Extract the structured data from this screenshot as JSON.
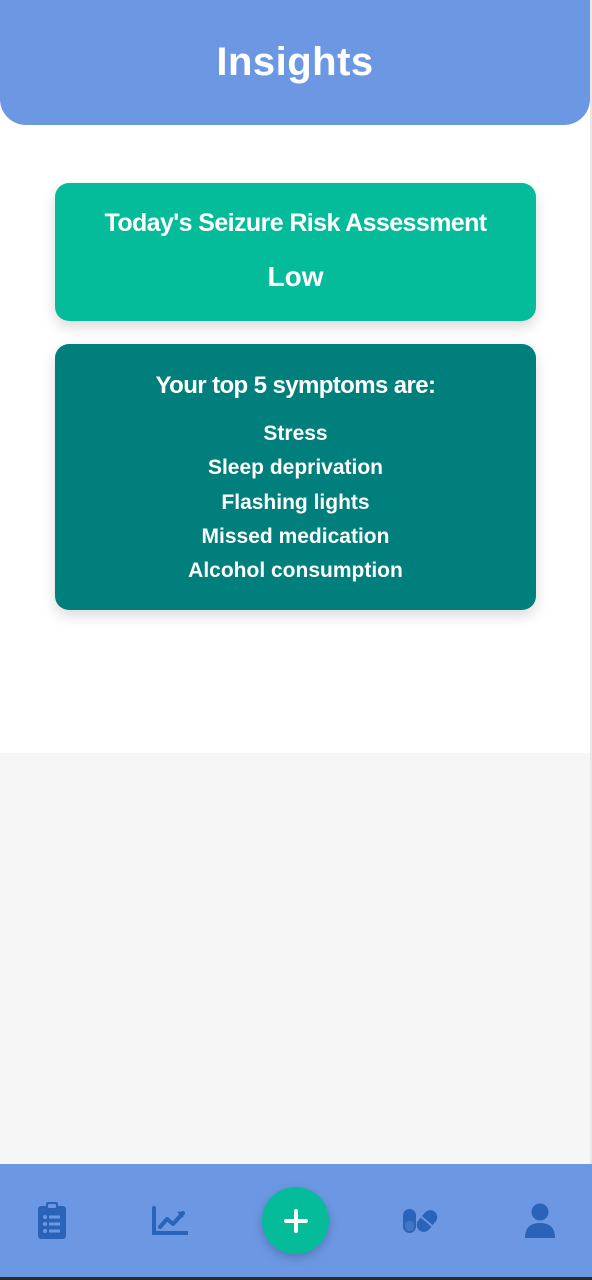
{
  "header": {
    "title": "Insights"
  },
  "risk_card": {
    "title": "Today's Seizure Risk Assessment",
    "level": "Low"
  },
  "symptoms_card": {
    "heading": "Your top 5 symptoms are:",
    "items": [
      "Stress",
      "Sleep deprivation",
      "Flashing lights",
      "Missed medication",
      "Alcohol consumption"
    ]
  },
  "bottom_nav": {
    "items": [
      {
        "icon": "clipboard-list-icon"
      },
      {
        "icon": "chart-line-icon"
      },
      {
        "icon": "plus-icon"
      },
      {
        "icon": "pills-icon"
      },
      {
        "icon": "user-icon"
      }
    ]
  },
  "colors": {
    "header": "#6c97e3",
    "risk_card": "#04bb9a",
    "symptoms_card": "#007f7c",
    "nav_icon": "#2a64b8",
    "fab": "#04bb9a"
  }
}
